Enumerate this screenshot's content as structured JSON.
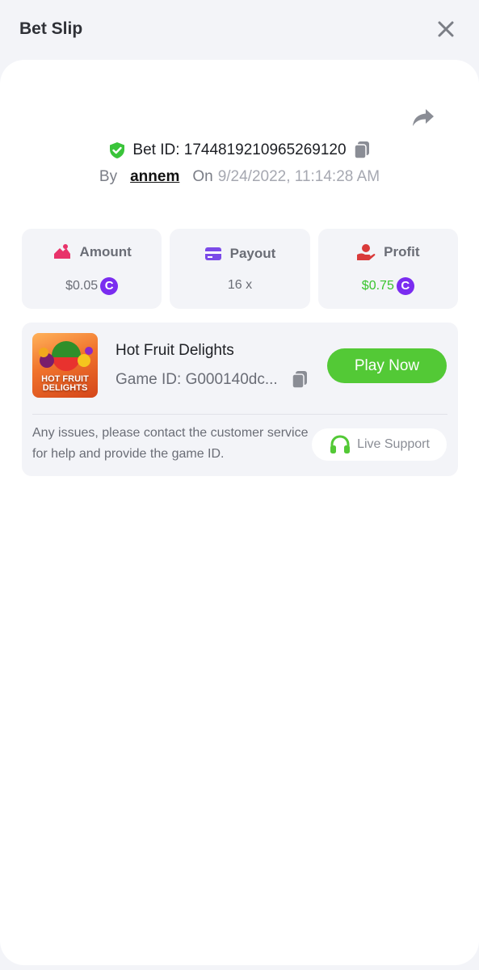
{
  "header": {
    "title": "Bet Slip"
  },
  "bet": {
    "id_label": "Bet ID: 1744819210965269120",
    "by_label": "By",
    "username": "annem",
    "on_label": "On",
    "datetime": "9/24/2022, 11:14:28 AM"
  },
  "stats": {
    "amount": {
      "label": "Amount",
      "value": "$0.05"
    },
    "payout": {
      "label": "Payout",
      "value": "16 x"
    },
    "profit": {
      "label": "Profit",
      "value": "$0.75"
    }
  },
  "currency_icon_glyph": "C",
  "game": {
    "thumbnail_text": "HOT FRUIT DELIGHTS",
    "title": "Hot Fruit Delights",
    "id_label": "Game ID: G000140dc...",
    "play_label": "Play Now"
  },
  "support": {
    "notice": "Any issues, please contact the customer service for help and provide the game ID.",
    "button_label": "Live Support"
  },
  "colors": {
    "accent_green": "#53c936",
    "profit_green": "#39c42e",
    "coin_purple": "#7a2cf0",
    "amount_icon_pink": "#e8336a",
    "payout_icon_purple": "#7b4ae8",
    "profit_icon_red": "#d93a3a"
  },
  "icons": [
    "close-icon",
    "share-icon",
    "shield-check-icon",
    "copy-icon",
    "amount-icon",
    "payout-card-icon",
    "profit-hand-icon",
    "coin-icon",
    "headset-icon"
  ]
}
